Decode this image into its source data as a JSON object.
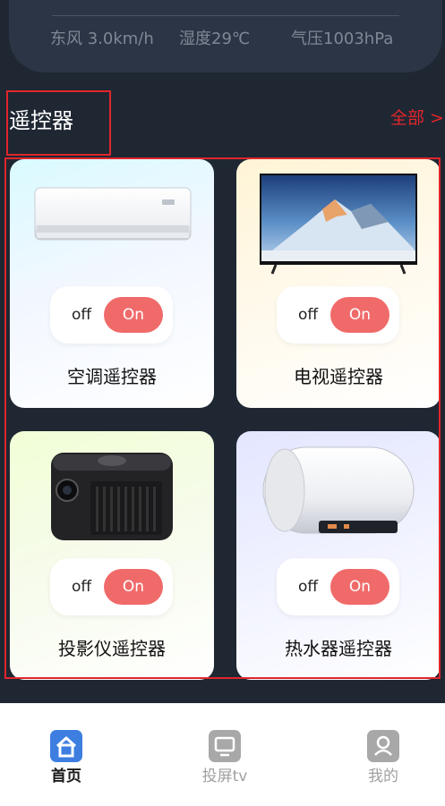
{
  "weather": {
    "wind": "东风 3.0km/h",
    "humidity": "湿度29℃",
    "pressure": "气压1003hPa"
  },
  "remotes": {
    "title": "遥控器",
    "view_all": "全部 >",
    "devices": [
      {
        "name": "空调遥控器",
        "off_label": "off",
        "on_label": "On",
        "icon": "air-conditioner-image"
      },
      {
        "name": "电视遥控器",
        "off_label": "off",
        "on_label": "On",
        "icon": "tv-image"
      },
      {
        "name": "投影仪遥控器",
        "off_label": "off",
        "on_label": "On",
        "icon": "projector-image"
      },
      {
        "name": "热水器遥控器",
        "off_label": "off",
        "on_label": "On",
        "icon": "water-heater-image"
      }
    ]
  },
  "tabbar": {
    "tabs": [
      {
        "label": "首页",
        "icon": "home-icon",
        "active": true
      },
      {
        "label": "投屏tv",
        "icon": "cast-screen-icon",
        "active": false
      },
      {
        "label": "我的",
        "icon": "profile-icon",
        "active": false
      }
    ]
  },
  "colors": {
    "background": "#1f2733",
    "card": "#2b3545",
    "accent_on": "#f06a6a",
    "highlight_red": "#e0262b",
    "tab_active": "#1a1a1a",
    "tab_inactive": "#a0a0a0"
  }
}
